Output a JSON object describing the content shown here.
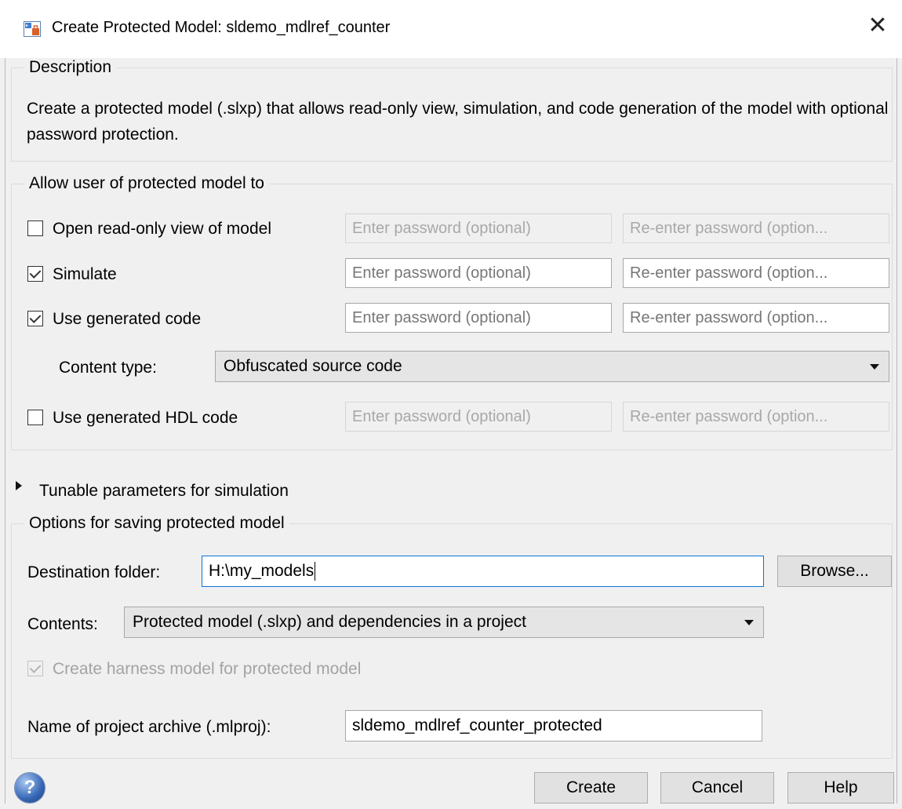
{
  "window": {
    "title": "Create Protected Model: sldemo_mdlref_counter",
    "close_glyph": "✕"
  },
  "description": {
    "legend": "Description",
    "text": "Create a protected model (.slxp) that allows read-only view, simulation, and code generation of the model with optional password protection."
  },
  "allow": {
    "legend": "Allow user of protected model to",
    "rows": [
      {
        "label": "Open read-only view of model",
        "checked": false,
        "pw_placeholder": "Enter password (optional)",
        "repw_placeholder": "Re-enter password (option...",
        "disabled": true
      },
      {
        "label": "Simulate",
        "checked": true,
        "pw_placeholder": "Enter password (optional)",
        "repw_placeholder": "Re-enter password (option...",
        "disabled": false
      },
      {
        "label": "Use generated code",
        "checked": true,
        "pw_placeholder": "Enter password (optional)",
        "repw_placeholder": "Re-enter password (option...",
        "disabled": false
      },
      {
        "label": "Use generated HDL code",
        "checked": false,
        "pw_placeholder": "Enter password (optional)",
        "repw_placeholder": "Re-enter password (option...",
        "disabled": true
      }
    ],
    "content_type_label": "Content type:",
    "content_type_value": "Obfuscated source code"
  },
  "tunable": {
    "label": "Tunable parameters for simulation",
    "expanded": false
  },
  "saving": {
    "legend": "Options for saving protected model",
    "destination_label": "Destination folder:",
    "destination_value": "H:\\my_models",
    "browse_label": "Browse...",
    "contents_label": "Contents:",
    "contents_value": "Protected model (.slxp) and dependencies in a project",
    "harness_label": "Create harness model for protected model",
    "harness_checked": true,
    "harness_disabled": true,
    "archive_label": "Name of project archive (.mlproj):",
    "archive_value": "sldemo_mdlref_counter_protected"
  },
  "buttons": {
    "create": "Create",
    "cancel": "Cancel",
    "help": "Help",
    "help_icon_glyph": "?"
  },
  "icons": [
    "app-icon",
    "close-icon",
    "chevron-down-icon",
    "expand-arrow-icon",
    "help-icon"
  ]
}
